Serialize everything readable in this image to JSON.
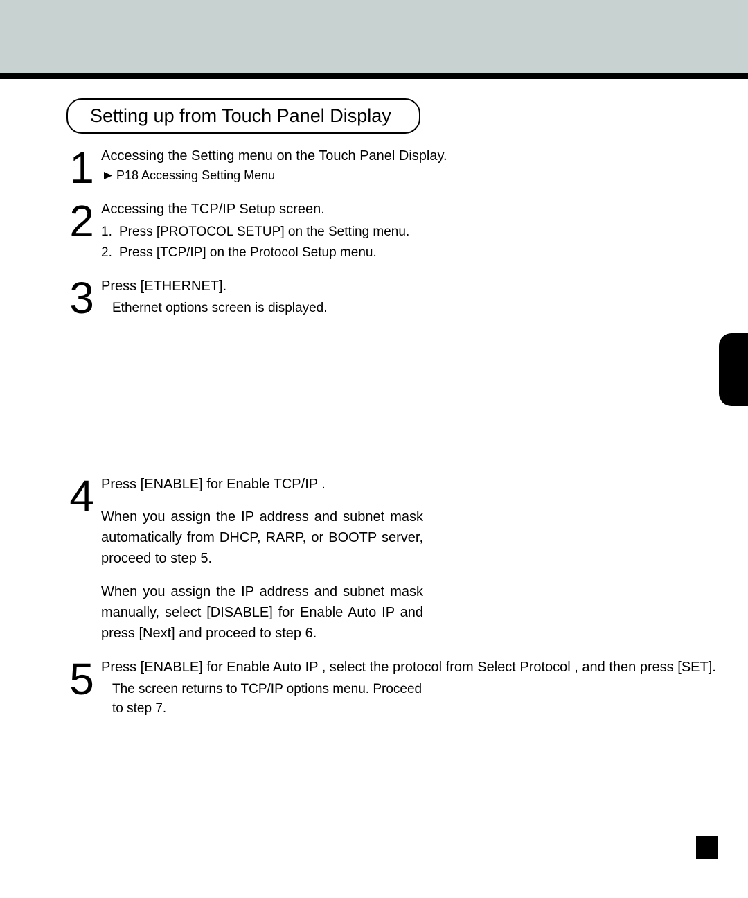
{
  "heading": "Setting up from Touch Panel Display",
  "steps": {
    "s1": {
      "num": "1",
      "title": "Accessing the Setting menu on the Touch Panel Display.",
      "ref": "P18  Accessing Setting Menu"
    },
    "s2": {
      "num": "2",
      "title": "Accessing the TCP/IP Setup screen.",
      "items": [
        {
          "n": "1.",
          "t": "Press [PROTOCOL SETUP] on the Setting menu."
        },
        {
          "n": "2.",
          "t": "Press [TCP/IP] on the Protocol Setup menu."
        }
      ]
    },
    "s3": {
      "num": "3",
      "title": "Press [ETHERNET].",
      "note": "Ethernet options screen is displayed."
    },
    "s4": {
      "num": "4",
      "title": "Press [ENABLE] for    Enable TCP/IP  .",
      "p1": "When you assign the IP address and subnet mask automatically from DHCP, RARP, or BOOTP server, proceed to step 5.",
      "p2": "When you assign the IP address and subnet mask manually, select [DISABLE] for    Enable Auto IP   and press [Next] and proceed to step 6."
    },
    "s5": {
      "num": "5",
      "title": "Press [ENABLE] for   Enable Auto IP , select the protocol from   Select Protocol , and then press [SET].",
      "note": "The screen returns to TCP/IP options menu.  Proceed to step 7."
    }
  }
}
